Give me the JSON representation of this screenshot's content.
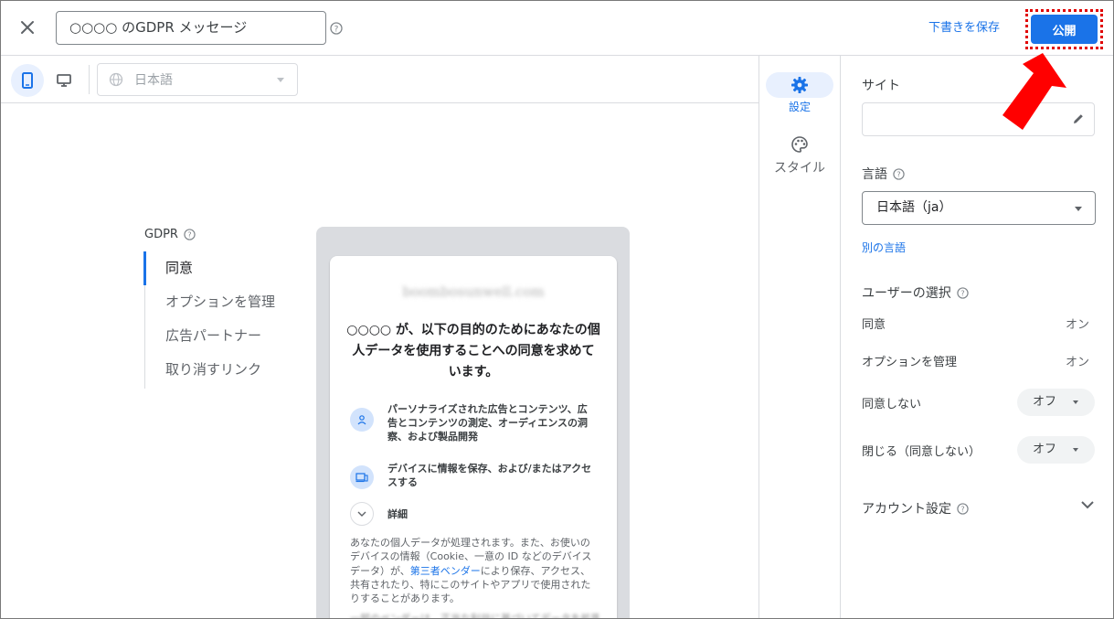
{
  "header": {
    "title_value": "○○○○ のGDPR メッセージ",
    "save_draft_label": "下書きを保存",
    "publish_label": "公開"
  },
  "toolbar": {
    "language_select_value": "日本語"
  },
  "left_nav": {
    "heading": "GDPR",
    "items": [
      {
        "label": "同意"
      },
      {
        "label": "オプションを管理"
      },
      {
        "label": "広告パートナー"
      },
      {
        "label": "取り消すリンク"
      }
    ]
  },
  "preview": {
    "domain_blurred": "boombosunwell.com",
    "headline": "○○○○ が、以下の目的のためにあなたの個人データを使用することへの同意を求めています。",
    "purposes": [
      {
        "icon": "person-icon",
        "text": "パーソナライズされた広告とコンテンツ、広告とコンテンツの測定、オーディエンスの洞察、および製品開発"
      },
      {
        "icon": "devices-icon",
        "text": "デバイスに情報を保存、および/またはアクセスする"
      }
    ],
    "details_label": "詳細",
    "body_before_link": "あなたの個人データが処理されます。また、お使いのデバイスの情報（Cookie、一意の ID などのデバイスデータ）が、",
    "body_link": "第三者ベンダー",
    "body_after_link": "により保存、アクセス、共有されたり、特にこのサイトやアプリで使用されたりすることがあります。",
    "body_blurred": "一部のベンダーは、正当な利益に基づいてデータを処理"
  },
  "rail": {
    "settings_label": "設定",
    "style_label": "スタイル"
  },
  "panel": {
    "site_label": "サイト",
    "site_value": "",
    "language_label": "言語",
    "language_value": "日本語（ja）",
    "other_language_link": "別の言語",
    "user_choice_label": "ユーザーの選択",
    "choices": [
      {
        "name": "同意",
        "value": "オン"
      },
      {
        "name": "オプションを管理",
        "value": "オン"
      },
      {
        "name": "同意しない",
        "value": "オフ"
      },
      {
        "name": "閉じる（同意しない）",
        "value": "オフ"
      }
    ],
    "account_settings_label": "アカウント設定"
  },
  "colors": {
    "accent": "#1a73e8",
    "annotation_red": "#ff0000"
  }
}
